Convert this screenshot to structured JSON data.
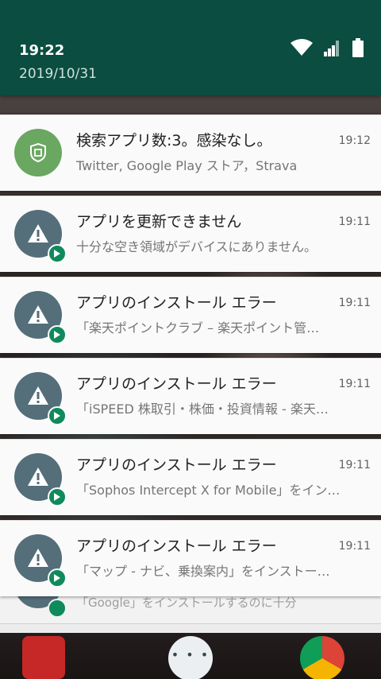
{
  "status_bar": {
    "time": "19:22",
    "date": "2019/10/31",
    "icons": [
      "wifi-icon",
      "cell-signal-icon",
      "battery-icon"
    ]
  },
  "notifications": [
    {
      "icon": "shield-icon",
      "icon_color": "#6aa761",
      "badge": null,
      "title": "検索アプリ数:3。感染なし。",
      "time": "19:12",
      "body": "Twitter, Google Play ストア，Strava"
    },
    {
      "icon": "warning-icon",
      "icon_color": "#546e7a",
      "badge": "play-store-icon",
      "title": "アプリを更新できません",
      "time": "19:11",
      "body": "十分な空き領域がデバイスにありません。"
    },
    {
      "icon": "warning-icon",
      "icon_color": "#546e7a",
      "badge": "play-store-icon",
      "title": "アプリのインストール エラー",
      "time": "19:11",
      "body": "「楽天ポイントクラブ – 楽天ポイント管…"
    },
    {
      "icon": "warning-icon",
      "icon_color": "#546e7a",
      "badge": "play-store-icon",
      "title": "アプリのインストール エラー",
      "time": "19:11",
      "body": "「iSPEED 株取引・株価・投資情報 - 楽天…"
    },
    {
      "icon": "warning-icon",
      "icon_color": "#546e7a",
      "badge": "play-store-icon",
      "title": "アプリのインストール エラー",
      "time": "19:11",
      "body": "「Sophos Intercept X for Mobile」をイン…"
    },
    {
      "icon": "warning-icon",
      "icon_color": "#546e7a",
      "badge": "play-store-icon",
      "title": "アプリのインストール エラー",
      "time": "19:11",
      "body": "「マップ - ナビ、乗換案内」をインストー…"
    }
  ],
  "stacked_hint": "「Google」をインストールするのに十分",
  "colors": {
    "header": "#0b4d40",
    "card": "#fafafa",
    "badge": "#0f8a5c"
  }
}
